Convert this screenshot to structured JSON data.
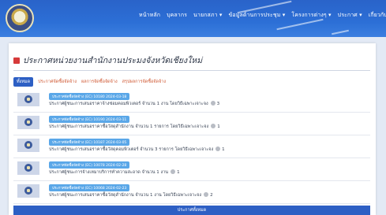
{
  "nav": {
    "items": [
      "หน้าหลัก",
      "บุคลากร",
      "นายกสภา ▾",
      "ข้อมูลด้านการประชุม ▾",
      "โครงการต่างๆ ▾",
      "ประกาศ ▾",
      "เกี่ยวกับเรา ▾"
    ]
  },
  "page": {
    "title": "ประกาศหน่วยงานสำนักงานประมงจังหวัดเชียงใหม่"
  },
  "filters": {
    "all_label": "ทั้งหมด",
    "items": [
      "ประกาศจัดซื้อจัดจ้าง",
      "ผลการจัดซื้อจัดจ้าง",
      "สรุปผลการจัดซื้อจัดจ้าง"
    ]
  },
  "announcements": [
    {
      "badge": "ประกาศจัดซื้อจัดจ้าง (EC) 10180 2024-03-18",
      "desc": "ประกาศผู้ชนะการเสนอราคาจ้างซ่อมคอมพิวเตอร์ จำนวน 1 งาน โดยวิธีเฉพาะเจาะจง",
      "count": "3"
    },
    {
      "badge": "ประกาศจัดซื้อจัดจ้าง (EC) 10190 2024-03-11",
      "desc": "ประกาศผู้ชนะการเสนอราคาซื้อวัสดุสำนักงาน จำนวน 1 รายการ โดยวิธีเฉพาะเจาะจง",
      "count": "1"
    },
    {
      "badge": "ประกาศจัดซื้อจัดจ้าง (EC) 10187 2024-03-05",
      "desc": "ประกาศผู้ชนะการเสนอราคาซื้อวัสดุคอมพิวเตอร์ จำนวน 3 รายการ โดยวิธีเฉพาะเจาะจง",
      "count": "1"
    },
    {
      "badge": "ประกาศจัดซื้อจัดจ้าง (EC) 10078 2024-02-28",
      "desc": "ประกาศผู้ชนะการจ้างเหมาบริการทำความสะอาด จำนวน 1 งาน",
      "count": "1"
    },
    {
      "badge": "ประกาศจัดซื้อจัดจ้าง (EC) 10068 2024-02-23",
      "desc": "ประกาศผู้ชนะการเสนอราคาซื้อวัสดุสำนักงาน จำนวน 1 งาน โดยวิธีเฉพาะเจาะจง",
      "count": "2"
    }
  ],
  "footer": {
    "button_label": "ประกาศทั้งหมด"
  },
  "colors": {
    "header": "#2c6fd6",
    "accent": "#2d5fc4",
    "badge": "#5aa7e8",
    "filter_link": "#d05a35",
    "title_icon": "#d63a3a"
  }
}
